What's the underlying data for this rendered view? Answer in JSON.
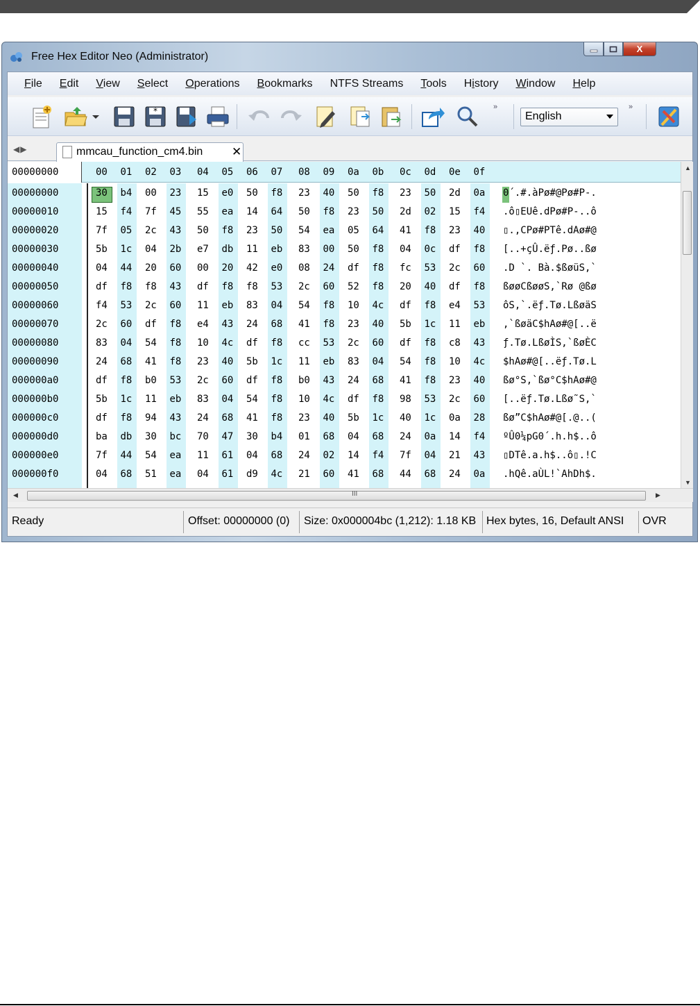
{
  "window": {
    "title": "Free Hex Editor Neo (Administrator)",
    "controls": {
      "minimize": "—",
      "maximize": "□",
      "close": "X"
    }
  },
  "menu": [
    "File",
    "Edit",
    "View",
    "Select",
    "Operations",
    "Bookmarks",
    "NTFS Streams",
    "Tools",
    "History",
    "Window",
    "Help"
  ],
  "toolbar": {
    "buttons": [
      "new-file-icon",
      "open-file-icon",
      "save-icon",
      "save-all-icon",
      "save-as-icon",
      "print-icon",
      "undo-icon",
      "redo-icon",
      "edit-icon",
      "copy-icon",
      "paste-icon",
      "export-icon",
      "find-icon",
      "settings-icon"
    ],
    "language": "English"
  },
  "tab": {
    "filename": "mmcau_function_cm4.bin",
    "close": "✕"
  },
  "hex": {
    "header_offset": "00000000",
    "columns": [
      "00",
      "01",
      "02",
      "03",
      "04",
      "05",
      "06",
      "07",
      "08",
      "09",
      "0a",
      "0b",
      "0c",
      "0d",
      "0e",
      "0f"
    ],
    "rows": [
      {
        "offset": "00000000",
        "bytes": [
          "30",
          "b4",
          "00",
          "23",
          "15",
          "e0",
          "50",
          "f8",
          "23",
          "40",
          "50",
          "f8",
          "23",
          "50",
          "2d",
          "0a"
        ],
        "ascii": "0´.#.àPø#@Pø#P-."
      },
      {
        "offset": "00000010",
        "bytes": [
          "15",
          "f4",
          "7f",
          "45",
          "55",
          "ea",
          "14",
          "64",
          "50",
          "f8",
          "23",
          "50",
          "2d",
          "02",
          "15",
          "f4"
        ],
        "ascii": ".ô▯EUê.dPø#P-..ô"
      },
      {
        "offset": "00000020",
        "bytes": [
          "7f",
          "05",
          "2c",
          "43",
          "50",
          "f8",
          "23",
          "50",
          "54",
          "ea",
          "05",
          "64",
          "41",
          "f8",
          "23",
          "40"
        ],
        "ascii": "▯.,CPø#PTê.dAø#@"
      },
      {
        "offset": "00000030",
        "bytes": [
          "5b",
          "1c",
          "04",
          "2b",
          "e7",
          "db",
          "11",
          "eb",
          "83",
          "00",
          "50",
          "f8",
          "04",
          "0c",
          "df",
          "f8"
        ],
        "ascii": "[..+çÛ.ëƒ.Pø..ßø"
      },
      {
        "offset": "00000040",
        "bytes": [
          "04",
          "44",
          "20",
          "60",
          "00",
          "20",
          "42",
          "e0",
          "08",
          "24",
          "df",
          "f8",
          "fc",
          "53",
          "2c",
          "60"
        ],
        "ascii": ".D `. Bà.$ßøüS,`"
      },
      {
        "offset": "00000050",
        "bytes": [
          "df",
          "f8",
          "f8",
          "43",
          "df",
          "f8",
          "f8",
          "53",
          "2c",
          "60",
          "52",
          "f8",
          "20",
          "40",
          "df",
          "f8"
        ],
        "ascii": "ßøøCßøøS,`Rø @ßø"
      },
      {
        "offset": "00000060",
        "bytes": [
          "f4",
          "53",
          "2c",
          "60",
          "11",
          "eb",
          "83",
          "04",
          "54",
          "f8",
          "10",
          "4c",
          "df",
          "f8",
          "e4",
          "53"
        ],
        "ascii": "ôS,`.ëƒ.Tø.LßøäS"
      },
      {
        "offset": "00000070",
        "bytes": [
          "2c",
          "60",
          "df",
          "f8",
          "e4",
          "43",
          "24",
          "68",
          "41",
          "f8",
          "23",
          "40",
          "5b",
          "1c",
          "11",
          "eb"
        ],
        "ascii": ",`ßøäC$hAø#@[..ë"
      },
      {
        "offset": "00000080",
        "bytes": [
          "83",
          "04",
          "54",
          "f8",
          "10",
          "4c",
          "df",
          "f8",
          "cc",
          "53",
          "2c",
          "60",
          "df",
          "f8",
          "c8",
          "43"
        ],
        "ascii": "ƒ.Tø.LßøÌS,`ßøÈC"
      },
      {
        "offset": "00000090",
        "bytes": [
          "24",
          "68",
          "41",
          "f8",
          "23",
          "40",
          "5b",
          "1c",
          "11",
          "eb",
          "83",
          "04",
          "54",
          "f8",
          "10",
          "4c"
        ],
        "ascii": "$hAø#@[..ëƒ.Tø.L"
      },
      {
        "offset": "000000a0",
        "bytes": [
          "df",
          "f8",
          "b0",
          "53",
          "2c",
          "60",
          "df",
          "f8",
          "b0",
          "43",
          "24",
          "68",
          "41",
          "f8",
          "23",
          "40"
        ],
        "ascii": "ßø°S,`ßø°C$hAø#@"
      },
      {
        "offset": "000000b0",
        "bytes": [
          "5b",
          "1c",
          "11",
          "eb",
          "83",
          "04",
          "54",
          "f8",
          "10",
          "4c",
          "df",
          "f8",
          "98",
          "53",
          "2c",
          "60"
        ],
        "ascii": "[..ëƒ.Tø.Lßø˜S,`"
      },
      {
        "offset": "000000c0",
        "bytes": [
          "df",
          "f8",
          "94",
          "43",
          "24",
          "68",
          "41",
          "f8",
          "23",
          "40",
          "5b",
          "1c",
          "40",
          "1c",
          "0a",
          "28"
        ],
        "ascii": "ßø”C$hAø#@[.@..("
      },
      {
        "offset": "000000d0",
        "bytes": [
          "ba",
          "db",
          "30",
          "bc",
          "70",
          "47",
          "30",
          "b4",
          "01",
          "68",
          "04",
          "68",
          "24",
          "0a",
          "14",
          "f4"
        ],
        "ascii": "ºÛ0¼pG0´.h.h$..ô"
      },
      {
        "offset": "000000e0",
        "bytes": [
          "7f",
          "44",
          "54",
          "ea",
          "11",
          "61",
          "04",
          "68",
          "24",
          "02",
          "14",
          "f4",
          "7f",
          "04",
          "21",
          "43"
        ],
        "ascii": "▯DTê.a.h$..ô▯.!C"
      },
      {
        "offset": "000000f0",
        "bytes": [
          "04",
          "68",
          "51",
          "ea",
          "04",
          "61",
          "d9",
          "4c",
          "21",
          "60",
          "41",
          "68",
          "44",
          "68",
          "24",
          "0a"
        ],
        "ascii": ".hQê.aÙL!`AhDh$."
      }
    ]
  },
  "scrollbar": {
    "grip": "III"
  },
  "status": {
    "state": "Ready",
    "offset": "Offset: 00000000 (0)",
    "size": "Size: 0x000004bc (1,212): 1.18 KB",
    "mode": "Hex bytes, 16, Default ANSI",
    "ovr": "OVR"
  }
}
